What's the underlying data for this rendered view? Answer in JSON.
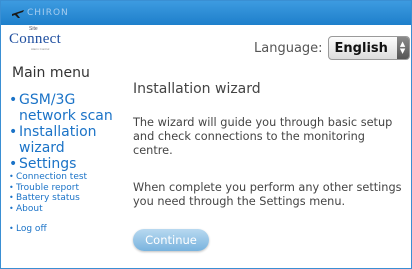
{
  "header": {
    "brand_text": "CHIRON"
  },
  "logo": {
    "small_text": "Site",
    "main_text": "Connect",
    "sub_text": "Alarm Control"
  },
  "language": {
    "label": "Language:",
    "selected": "English"
  },
  "menu": {
    "title": "Main menu",
    "items": [
      {
        "label": "GSM/3G network scan"
      },
      {
        "label": "Installation wizard"
      },
      {
        "label": "Settings"
      },
      {
        "label": "Connection test"
      },
      {
        "label": "Trouble report"
      },
      {
        "label": "Battery status"
      },
      {
        "label": "About"
      },
      {
        "label": "Log off"
      }
    ]
  },
  "content": {
    "title": "Installation wizard",
    "paragraph1": "The wizard will guide you through basic setup and check connections to the monitoring centre.",
    "paragraph2": "When complete you perform any other settings you need through the Settings menu.",
    "continue_label": "Continue"
  },
  "colors": {
    "topbar": "#1e7fcb",
    "link": "#1b73c7",
    "button": "#79b3de"
  }
}
